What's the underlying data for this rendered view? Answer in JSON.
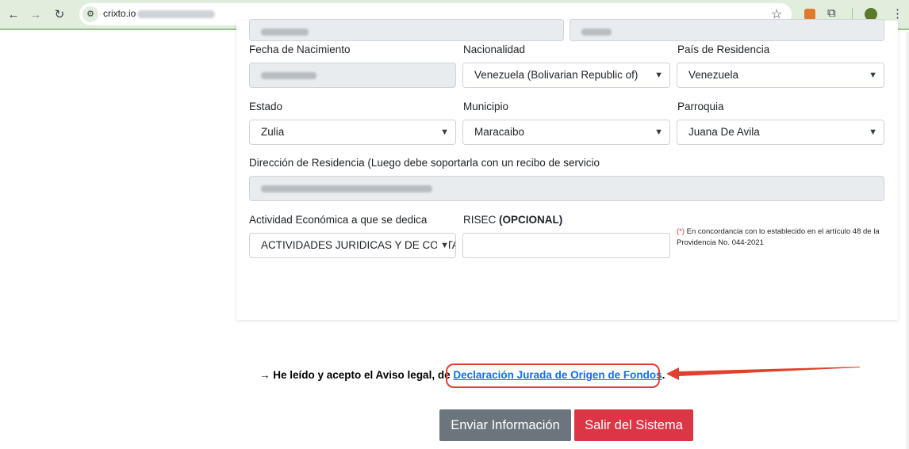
{
  "browser": {
    "url_domain": "crixto.io",
    "url_path_hidden": "/verificar-identidad"
  },
  "form": {
    "first_name_value": "Victor Daniel",
    "last_name_value": "Velasco",
    "labels": {
      "birth_date": "Fecha de Nacimiento",
      "nationality": "Nacionalidad",
      "residence_country": "País de Residencia",
      "state": "Estado",
      "municipality": "Municipio",
      "parish": "Parroquia",
      "address": "Dirección de Residencia (Luego debe soportarla con un recibo de servicio",
      "economic_activity": "Actividad Económica a que se dedica",
      "risec": "RISEC",
      "risec_optional": "(OPCIONAL)"
    },
    "values": {
      "birth_date": "12/01/2001",
      "nationality": "Venezuela (Bolivarian Republic of)",
      "residence_country": "Venezuela",
      "state": "Zulia",
      "municipality": "Maracaibo",
      "parish": "Juana De Avila",
      "address": "Urb. Las Tinitarias San Diego 2006",
      "economic_activity": "ACTIVIDADES JURIDICAS Y DE CONTABILIDAD",
      "risec": ""
    },
    "note_marker": "(*)",
    "note_text": " En concordancia con lo establecido en el artículo 48 de la Providencia No. 044-2021"
  },
  "consent": {
    "prefix": "→ He leído y acepto el Aviso legal, de ",
    "link": "Declaración Jurada de Origen de Fondos",
    "suffix": "."
  },
  "buttons": {
    "send": "Enviar Información",
    "exit": "Salir del Sistema"
  },
  "colors": {
    "accent_link": "#0d6efd",
    "highlight": "#e0412f",
    "send_button": "#6c757d",
    "exit_button": "#dc3545"
  }
}
